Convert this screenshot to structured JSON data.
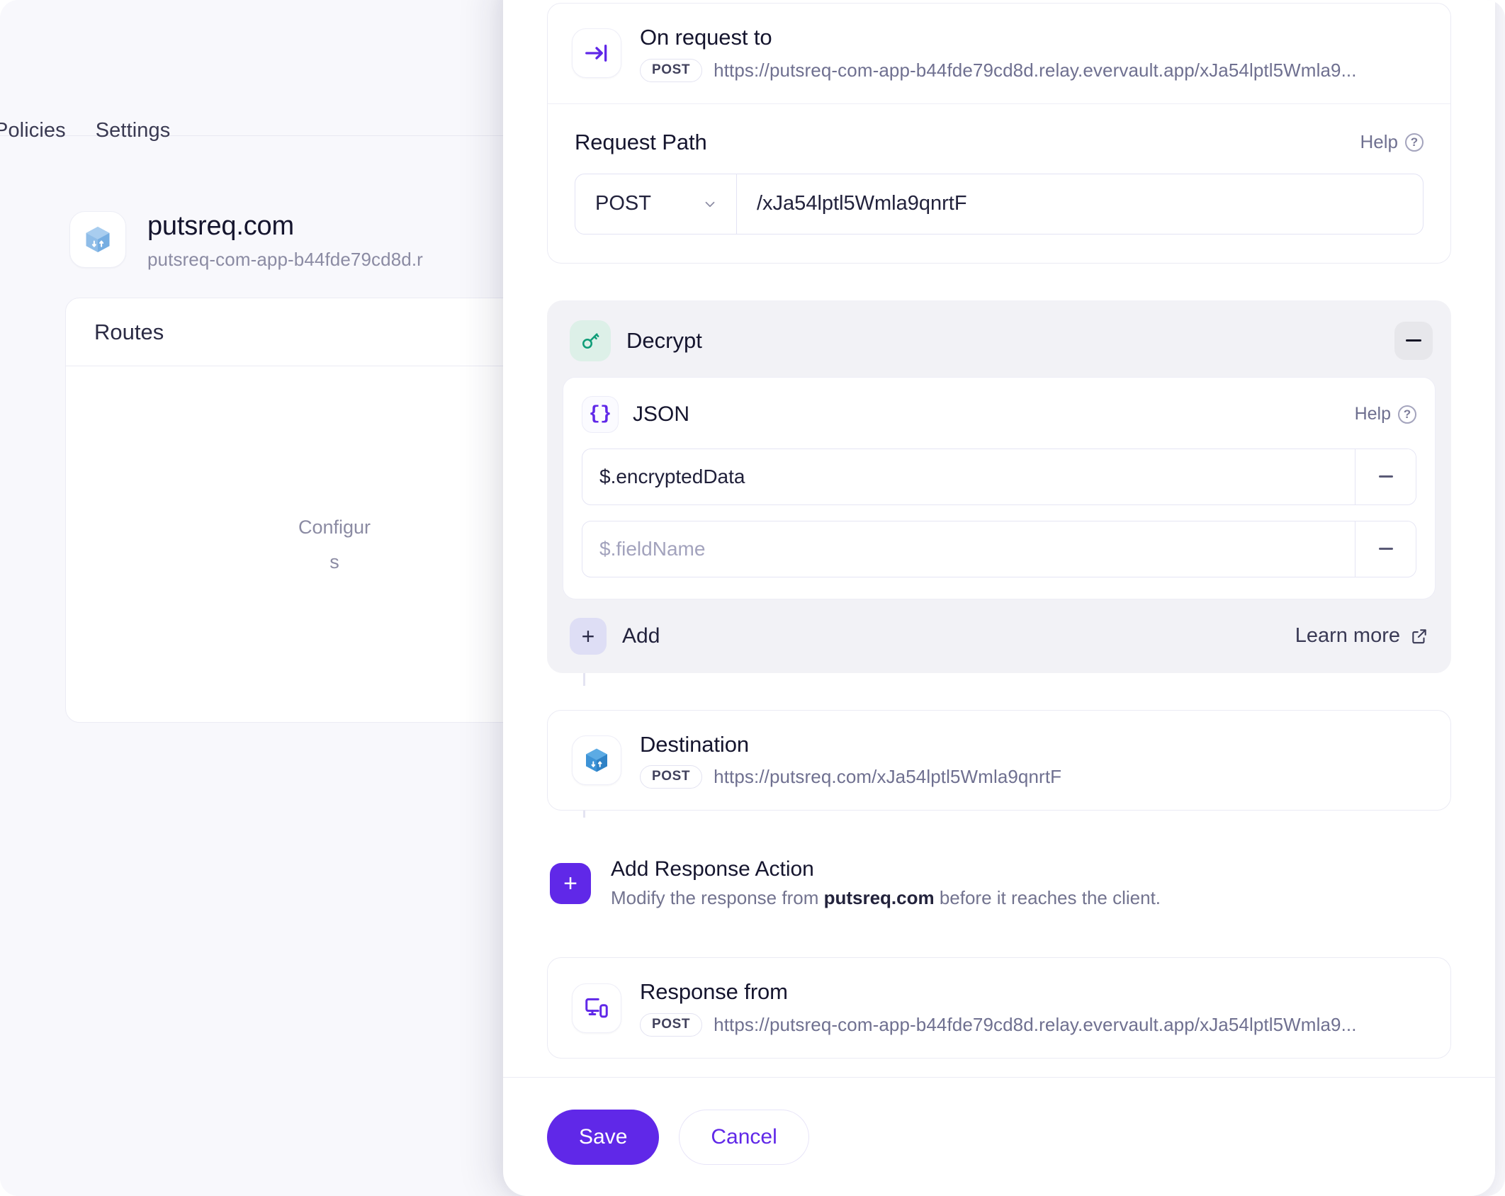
{
  "background": {
    "tabs": [
      {
        "label": "Policies"
      },
      {
        "label": "Settings"
      }
    ],
    "app": {
      "icon": "cube-icon",
      "title": "putsreq.com",
      "subtitle": "putsreq-com-app-b44fde79cd8d.r"
    },
    "card": {
      "header": "Routes",
      "empty_line1": "Configur",
      "empty_line2": "s"
    }
  },
  "modal": {
    "request": {
      "icon": "arrow-into-bar-icon",
      "title": "On request to",
      "method": "POST",
      "url": "https://putsreq-com-app-b44fde79cd8d.relay.evervault.app/xJa54lptl5Wmla9..."
    },
    "request_path": {
      "label": "Request Path",
      "help_label": "Help",
      "method_value": "POST",
      "path_value": "/xJa54lptl5Wmla9qnrtF"
    },
    "decrypt": {
      "icon": "key-icon",
      "title": "Decrypt",
      "collapse_label": "−",
      "json": {
        "icon": "braces-icon",
        "title": "JSON",
        "help_label": "Help",
        "fields": [
          {
            "value": "$.encryptedData",
            "placeholder": "$.fieldName"
          },
          {
            "value": "",
            "placeholder": "$.fieldName"
          }
        ]
      },
      "add_label": "Add",
      "learn_more_label": "Learn more"
    },
    "destination": {
      "icon": "cube-icon",
      "title": "Destination",
      "method": "POST",
      "url": "https://putsreq.com/xJa54lptl5Wmla9qnrtF"
    },
    "add_response_action": {
      "icon": "plus-icon",
      "title": "Add Response Action",
      "subtitle_prefix": "Modify the response from ",
      "subtitle_bold": "putsreq.com",
      "subtitle_suffix": " before it reaches the client."
    },
    "response": {
      "icon": "monitor-icon",
      "title": "Response from",
      "method": "POST",
      "url": "https://putsreq-com-app-b44fde79cd8d.relay.evervault.app/xJa54lptl5Wmla9..."
    },
    "footer": {
      "save_label": "Save",
      "cancel_label": "Cancel"
    }
  },
  "colors": {
    "accent": "#6028e8",
    "decrypt_icon_bg": "#ddf0e8",
    "decrypt_icon_fg": "#0f9d78",
    "group_bg": "#f2f2f6",
    "page_bg": "#f8f8fc"
  }
}
